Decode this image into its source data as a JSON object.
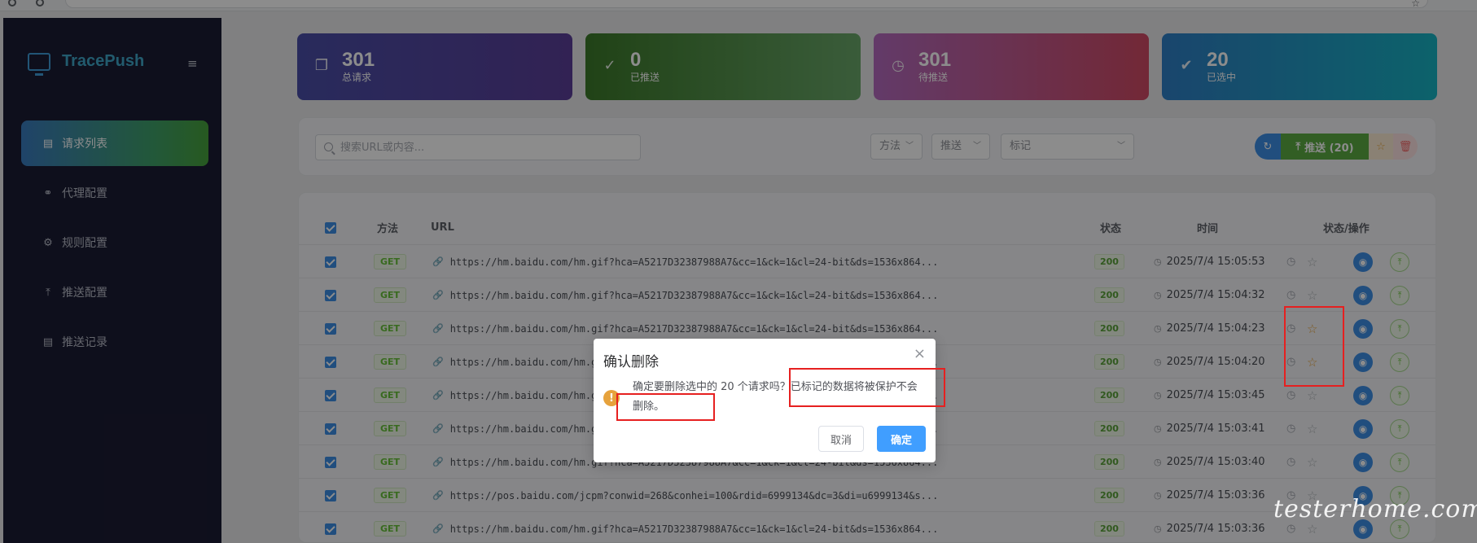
{
  "app": {
    "name": "TracePush"
  },
  "sidebar": {
    "items": [
      {
        "label": "请求列表",
        "icon": "clipboard-icon",
        "active": true
      },
      {
        "label": "代理配置",
        "icon": "link-icon",
        "active": false
      },
      {
        "label": "规则配置",
        "icon": "gear-icon",
        "active": false
      },
      {
        "label": "推送配置",
        "icon": "upload-icon",
        "active": false
      },
      {
        "label": "推送记录",
        "icon": "clipboard-icon",
        "active": false
      }
    ]
  },
  "stats": [
    {
      "value": "301",
      "label": "总请求",
      "icon": "document-icon",
      "gradient": [
        "#4a4ea8",
        "#5b3f99"
      ]
    },
    {
      "value": "0",
      "label": "已推送",
      "icon": "check-circle-icon",
      "gradient": [
        "#3c7a2a",
        "#6aa86a"
      ]
    },
    {
      "value": "301",
      "label": "待推送",
      "icon": "clock-icon",
      "gradient": [
        "#b46bbf",
        "#d04a64"
      ]
    },
    {
      "value": "20",
      "label": "已选中",
      "icon": "check-icon",
      "gradient": [
        "#2f7fc6",
        "#17b3c4"
      ]
    }
  ],
  "toolbar": {
    "search_placeholder": "搜索URL或内容...",
    "method_filter": "方法",
    "push_filter": "推送",
    "mark_filter": "标记",
    "push_button": "推送 (20)"
  },
  "table": {
    "headers": {
      "method": "方法",
      "url": "URL",
      "status": "状态",
      "time": "时间",
      "ops": "状态/操作"
    },
    "rows": [
      {
        "method": "GET",
        "url": "https://hm.baidu.com/hm.gif?hca=A5217D32387988A7&cc=1&ck=1&cl=24-bit&ds=1536x864...",
        "status": "200",
        "time": "2025/7/4 15:05:53",
        "marked": false
      },
      {
        "method": "GET",
        "url": "https://hm.baidu.com/hm.gif?hca=A5217D32387988A7&cc=1&ck=1&cl=24-bit&ds=1536x864...",
        "status": "200",
        "time": "2025/7/4 15:04:32",
        "marked": false
      },
      {
        "method": "GET",
        "url": "https://hm.baidu.com/hm.gif?hca=A5217D32387988A7&cc=1&ck=1&cl=24-bit&ds=1536x864...",
        "status": "200",
        "time": "2025/7/4 15:04:23",
        "marked": true
      },
      {
        "method": "GET",
        "url": "https://hm.baidu.com/hm.gif?hca=A5217D32387988A7&cc=1&ck=1&cl=24-bit&ds=1536x864...",
        "status": "200",
        "time": "2025/7/4 15:04:20",
        "marked": true
      },
      {
        "method": "GET",
        "url": "https://hm.baidu.com/hm.gif?hca=A5217D32387988A7&cc=1&ck=1&cl=24-bit&ds=1536x864...",
        "status": "200",
        "time": "2025/7/4 15:03:45",
        "marked": false
      },
      {
        "method": "GET",
        "url": "https://hm.baidu.com/hm.gif?hca=A5217D32387988A7&cc=1&ck=1&cl=24-bit&ds=1536x864...",
        "status": "200",
        "time": "2025/7/4 15:03:41",
        "marked": false
      },
      {
        "method": "GET",
        "url": "https://hm.baidu.com/hm.gif?hca=A5217D32387988A7&cc=1&ck=1&cl=24-bit&ds=1536x864...",
        "status": "200",
        "time": "2025/7/4 15:03:40",
        "marked": false
      },
      {
        "method": "GET",
        "url": "https://pos.baidu.com/jcpm?conwid=268&conhei=100&rdid=6999134&dc=3&di=u6999134&s...",
        "status": "200",
        "time": "2025/7/4 15:03:36",
        "marked": false
      },
      {
        "method": "GET",
        "url": "https://hm.baidu.com/hm.gif?hca=A5217D32387988A7&cc=1&ck=1&cl=24-bit&ds=1536x864...",
        "status": "200",
        "time": "2025/7/4 15:03:36",
        "marked": false
      }
    ]
  },
  "dialog": {
    "title": "确认删除",
    "message": "确定要删除选中的 20 个请求吗？已标记的数据将被保护不会删除。",
    "cancel": "取消",
    "confirm": "确定"
  },
  "watermark": "testerhome.com"
}
